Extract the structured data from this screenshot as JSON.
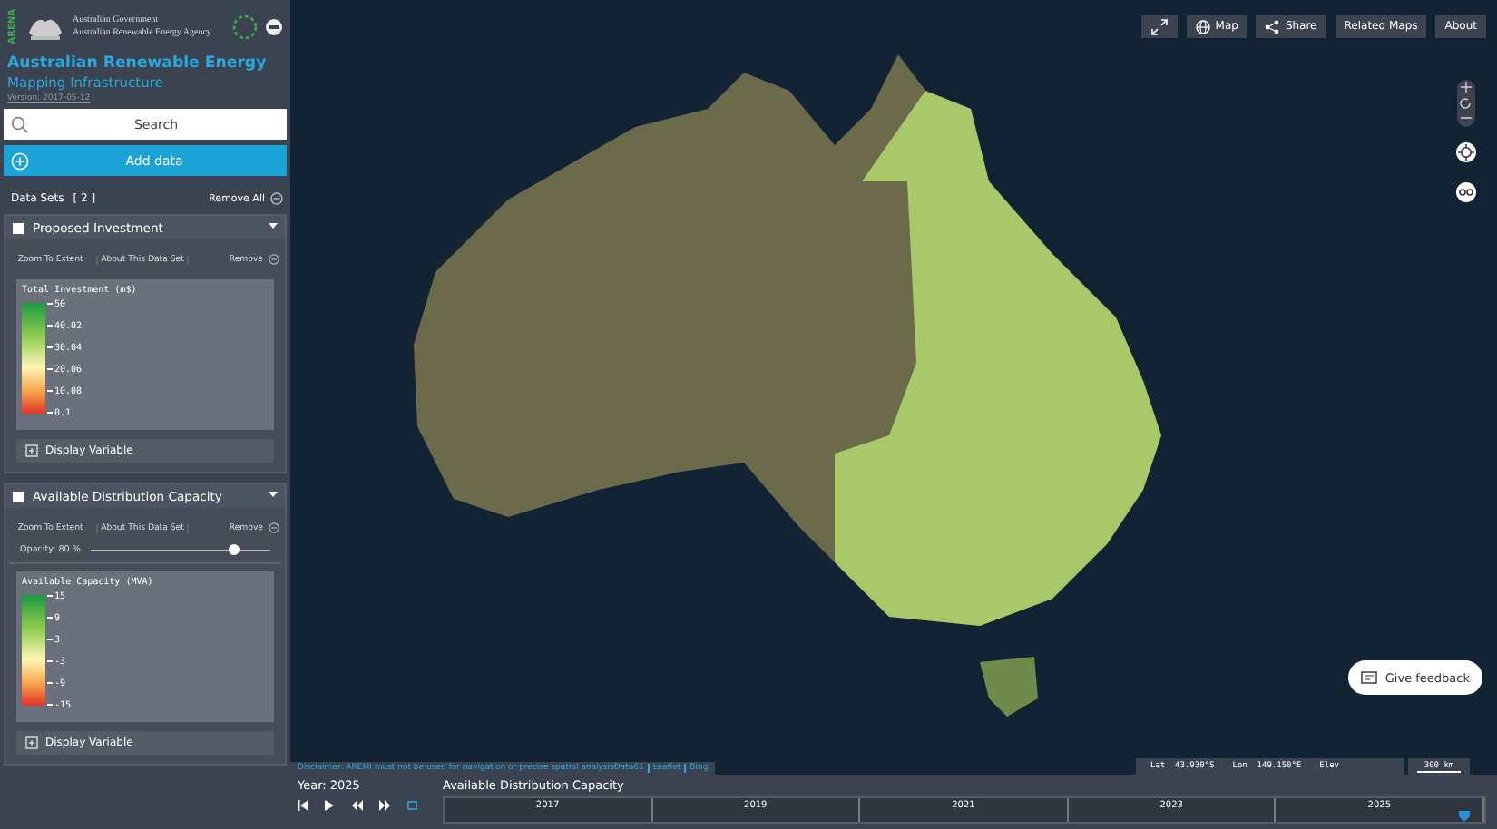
{
  "header": {
    "logo_text": "ARENA",
    "agency_lines": [
      "Australian Government",
      "Australian Renewable Energy Agency"
    ],
    "title": "Australian Renewable Energy",
    "subtitle": "Mapping Infrastructure",
    "version": "Version: 2017-05-12"
  },
  "search": {
    "placeholder": "Search"
  },
  "add_data": "Add data",
  "datasets_header": {
    "label": "Data Sets",
    "count": "[ 2 ]",
    "remove_all": "Remove All"
  },
  "datasets": [
    {
      "title": "Proposed Investment",
      "checked": true,
      "expanded": true,
      "actions": [
        "Zoom To Extent",
        "About This Data Set",
        "Remove"
      ],
      "legend": {
        "title": "Total Investment (m$)",
        "ticks": [
          "50",
          "40.02",
          "30.04",
          "20.06",
          "10.08",
          "0.1"
        ]
      },
      "display_variable": "Display Variable"
    },
    {
      "title": "Available Distribution Capacity",
      "checked": true,
      "expanded": true,
      "actions": [
        "Zoom To Extent",
        "About This Data Set",
        "Remove"
      ],
      "opacity": {
        "label": "Opacity: 80 %",
        "level": 0.8
      },
      "legend": {
        "title": "Available Capacity (MVA)",
        "ticks": [
          "15",
          "9",
          "3",
          "-3",
          "-9",
          "-15"
        ]
      },
      "display_variable": "Display Variable"
    }
  ],
  "toolbar": [
    {
      "kind": "fullscreen"
    },
    {
      "kind": "map",
      "label": "Map"
    },
    {
      "kind": "share",
      "label": "Share"
    },
    {
      "kind": "text",
      "label": "Related Maps"
    },
    {
      "kind": "text",
      "label": "About"
    }
  ],
  "feedback": "Give feedback",
  "attribution": [
    "Disclaimer: AREMI must not be used for navigation or precise spatial analysisData61",
    "Leaflet",
    "Bing"
  ],
  "location": {
    "lat": "Lat  43.930°S",
    "lon": "Lon  149.150°E",
    "elev": "Elev"
  },
  "scale": "300 km",
  "timeline": {
    "year": "Year: 2025",
    "title": "Available Distribution Capacity",
    "years": [
      "2017",
      "2019",
      "2021",
      "2023",
      "2025"
    ],
    "level": 0.98
  }
}
